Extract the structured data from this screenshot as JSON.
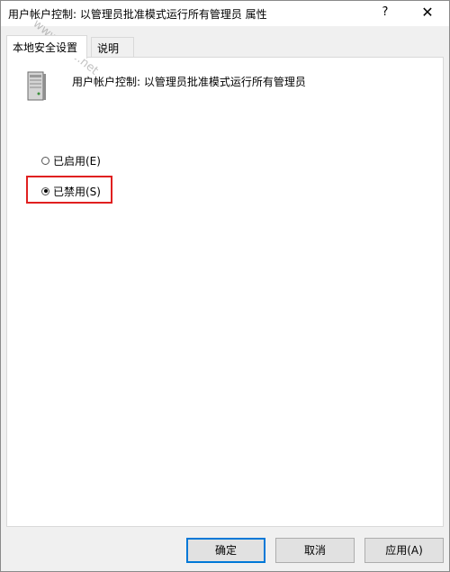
{
  "window": {
    "title": "用户帐户控制: 以管理员批准模式运行所有管理员 属性",
    "help_glyph": "?",
    "close_glyph": "✕"
  },
  "tabs": [
    {
      "label": "本地安全设置",
      "active": true
    },
    {
      "label": "说明",
      "active": false
    }
  ],
  "policy": {
    "icon": "server-icon",
    "title": "用户帐户控制: 以管理员批准模式运行所有管理员"
  },
  "options": {
    "enabled": {
      "label": "已启用(E)",
      "checked": false
    },
    "disabled": {
      "label": "已禁用(S)",
      "checked": true
    }
  },
  "buttons": {
    "ok": "确定",
    "cancel": "取消",
    "apply": "应用(A)"
  },
  "watermark": "www.jb51.net",
  "colors": {
    "highlight": "#e02020",
    "ok_border": "#0078d7"
  }
}
